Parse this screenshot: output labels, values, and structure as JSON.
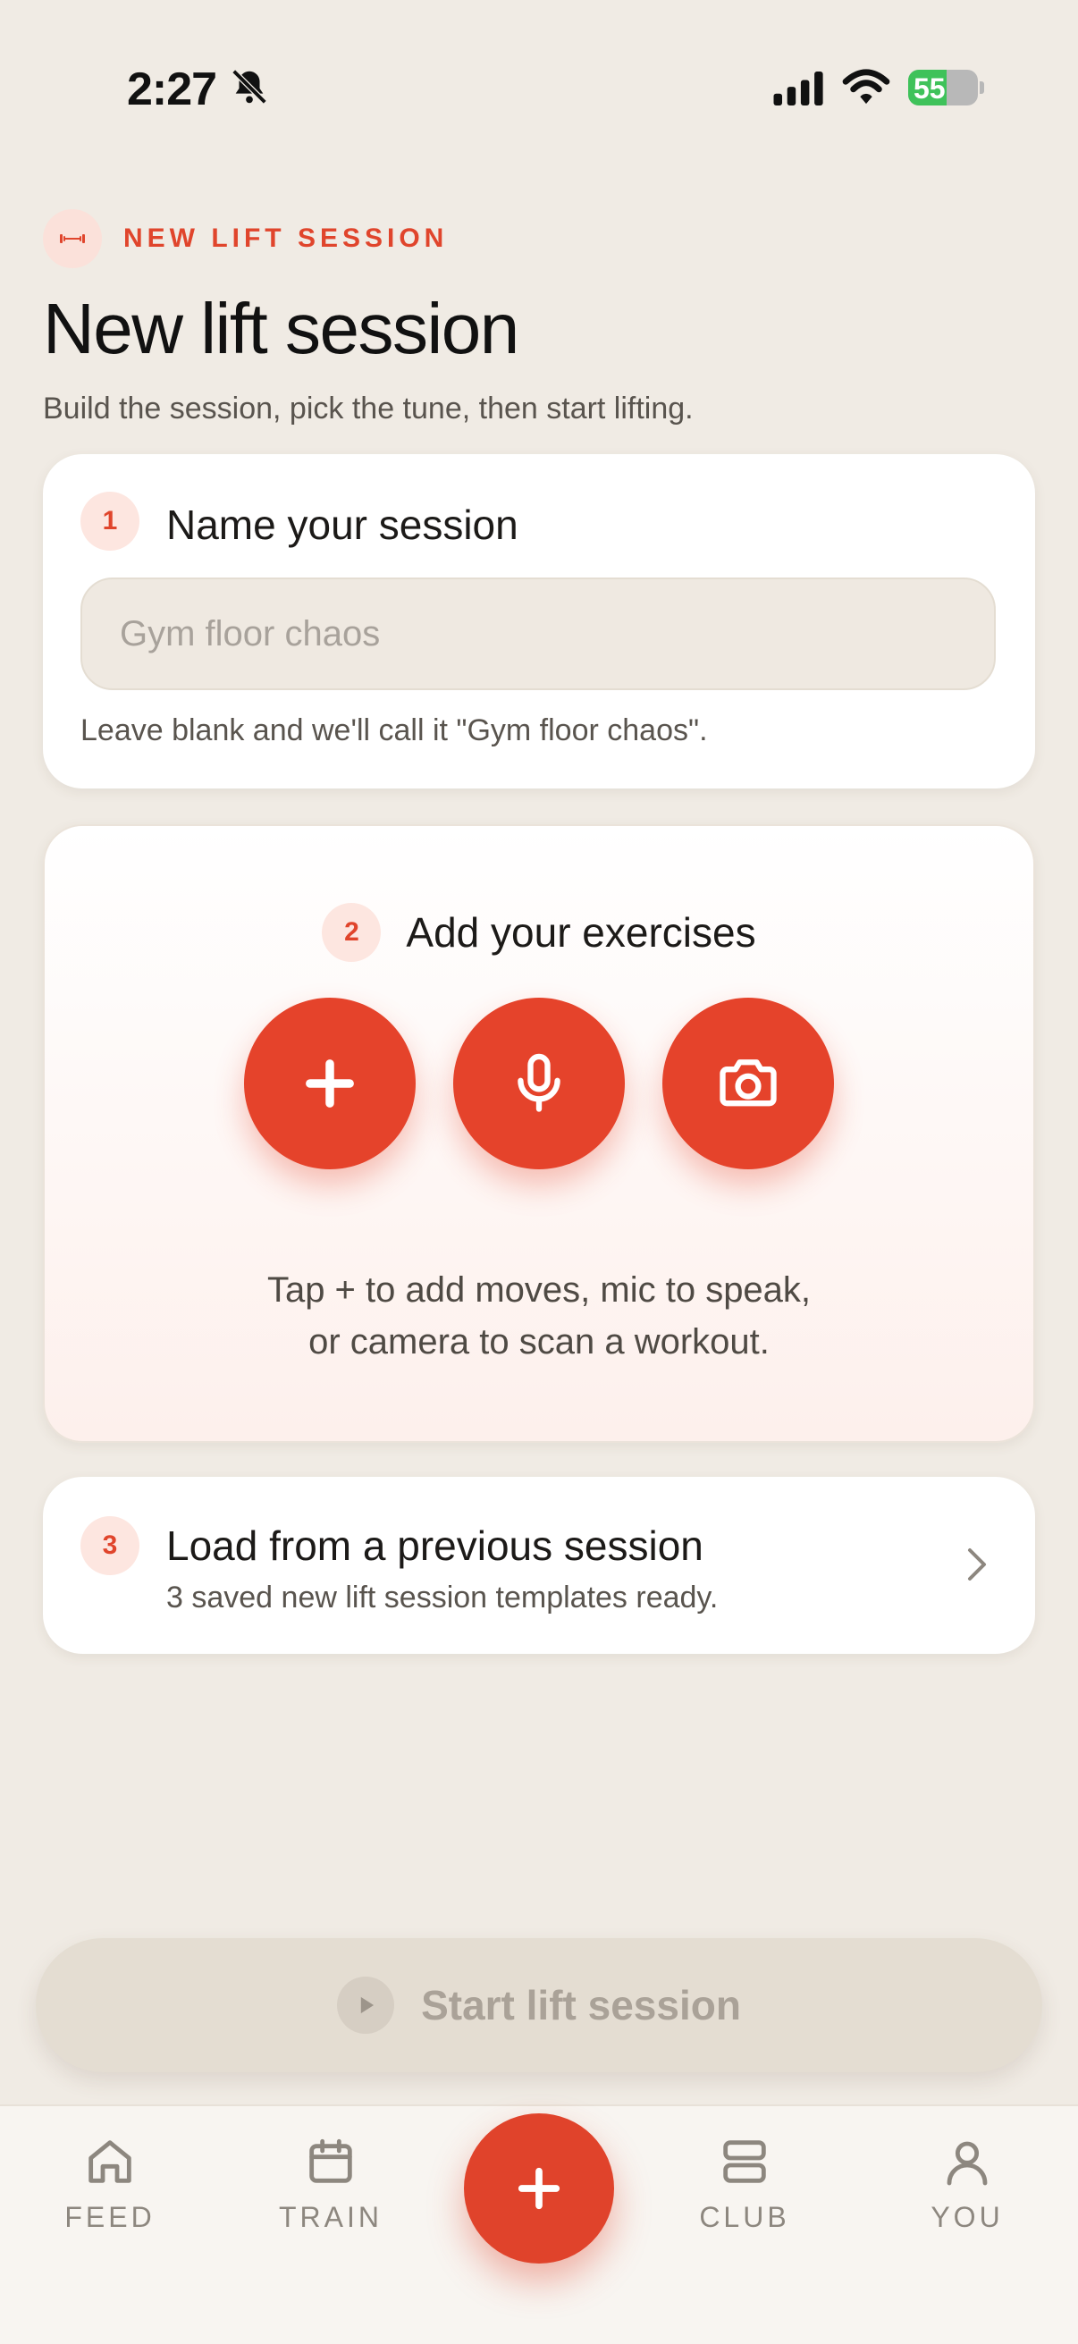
{
  "status_bar": {
    "time": "2:27",
    "battery": "55",
    "battery_level": 0.55
  },
  "header": {
    "eyebrow": "NEW LIFT SESSION",
    "title": "New lift session",
    "subtitle": "Build the session, pick the tune, then start lifting."
  },
  "step1": {
    "number": "1",
    "title": "Name your session",
    "placeholder": "Gym floor chaos",
    "hint": "Leave blank and we'll call it \"Gym floor chaos\"."
  },
  "step2": {
    "number": "2",
    "title": "Add your exercises",
    "hint_line1": "Tap + to add moves, mic to speak,",
    "hint_line2": "or camera to scan a workout.",
    "actions": [
      "plus-icon",
      "microphone-icon",
      "camera-icon"
    ]
  },
  "step3": {
    "number": "3",
    "title": "Load from a previous session",
    "subtitle": "3 saved new lift session templates ready."
  },
  "start_button": {
    "label": "Start lift session"
  },
  "tabs": [
    {
      "label": "FEED",
      "icon": "home-icon"
    },
    {
      "label": "TRAIN",
      "icon": "calendar-icon"
    },
    {
      "label": "CLUB",
      "icon": "stack-icon"
    },
    {
      "label": "YOU",
      "icon": "person-icon"
    }
  ],
  "colors": {
    "accent": "#e5432b",
    "background": "#f0ebe4",
    "card": "#ffffff"
  }
}
